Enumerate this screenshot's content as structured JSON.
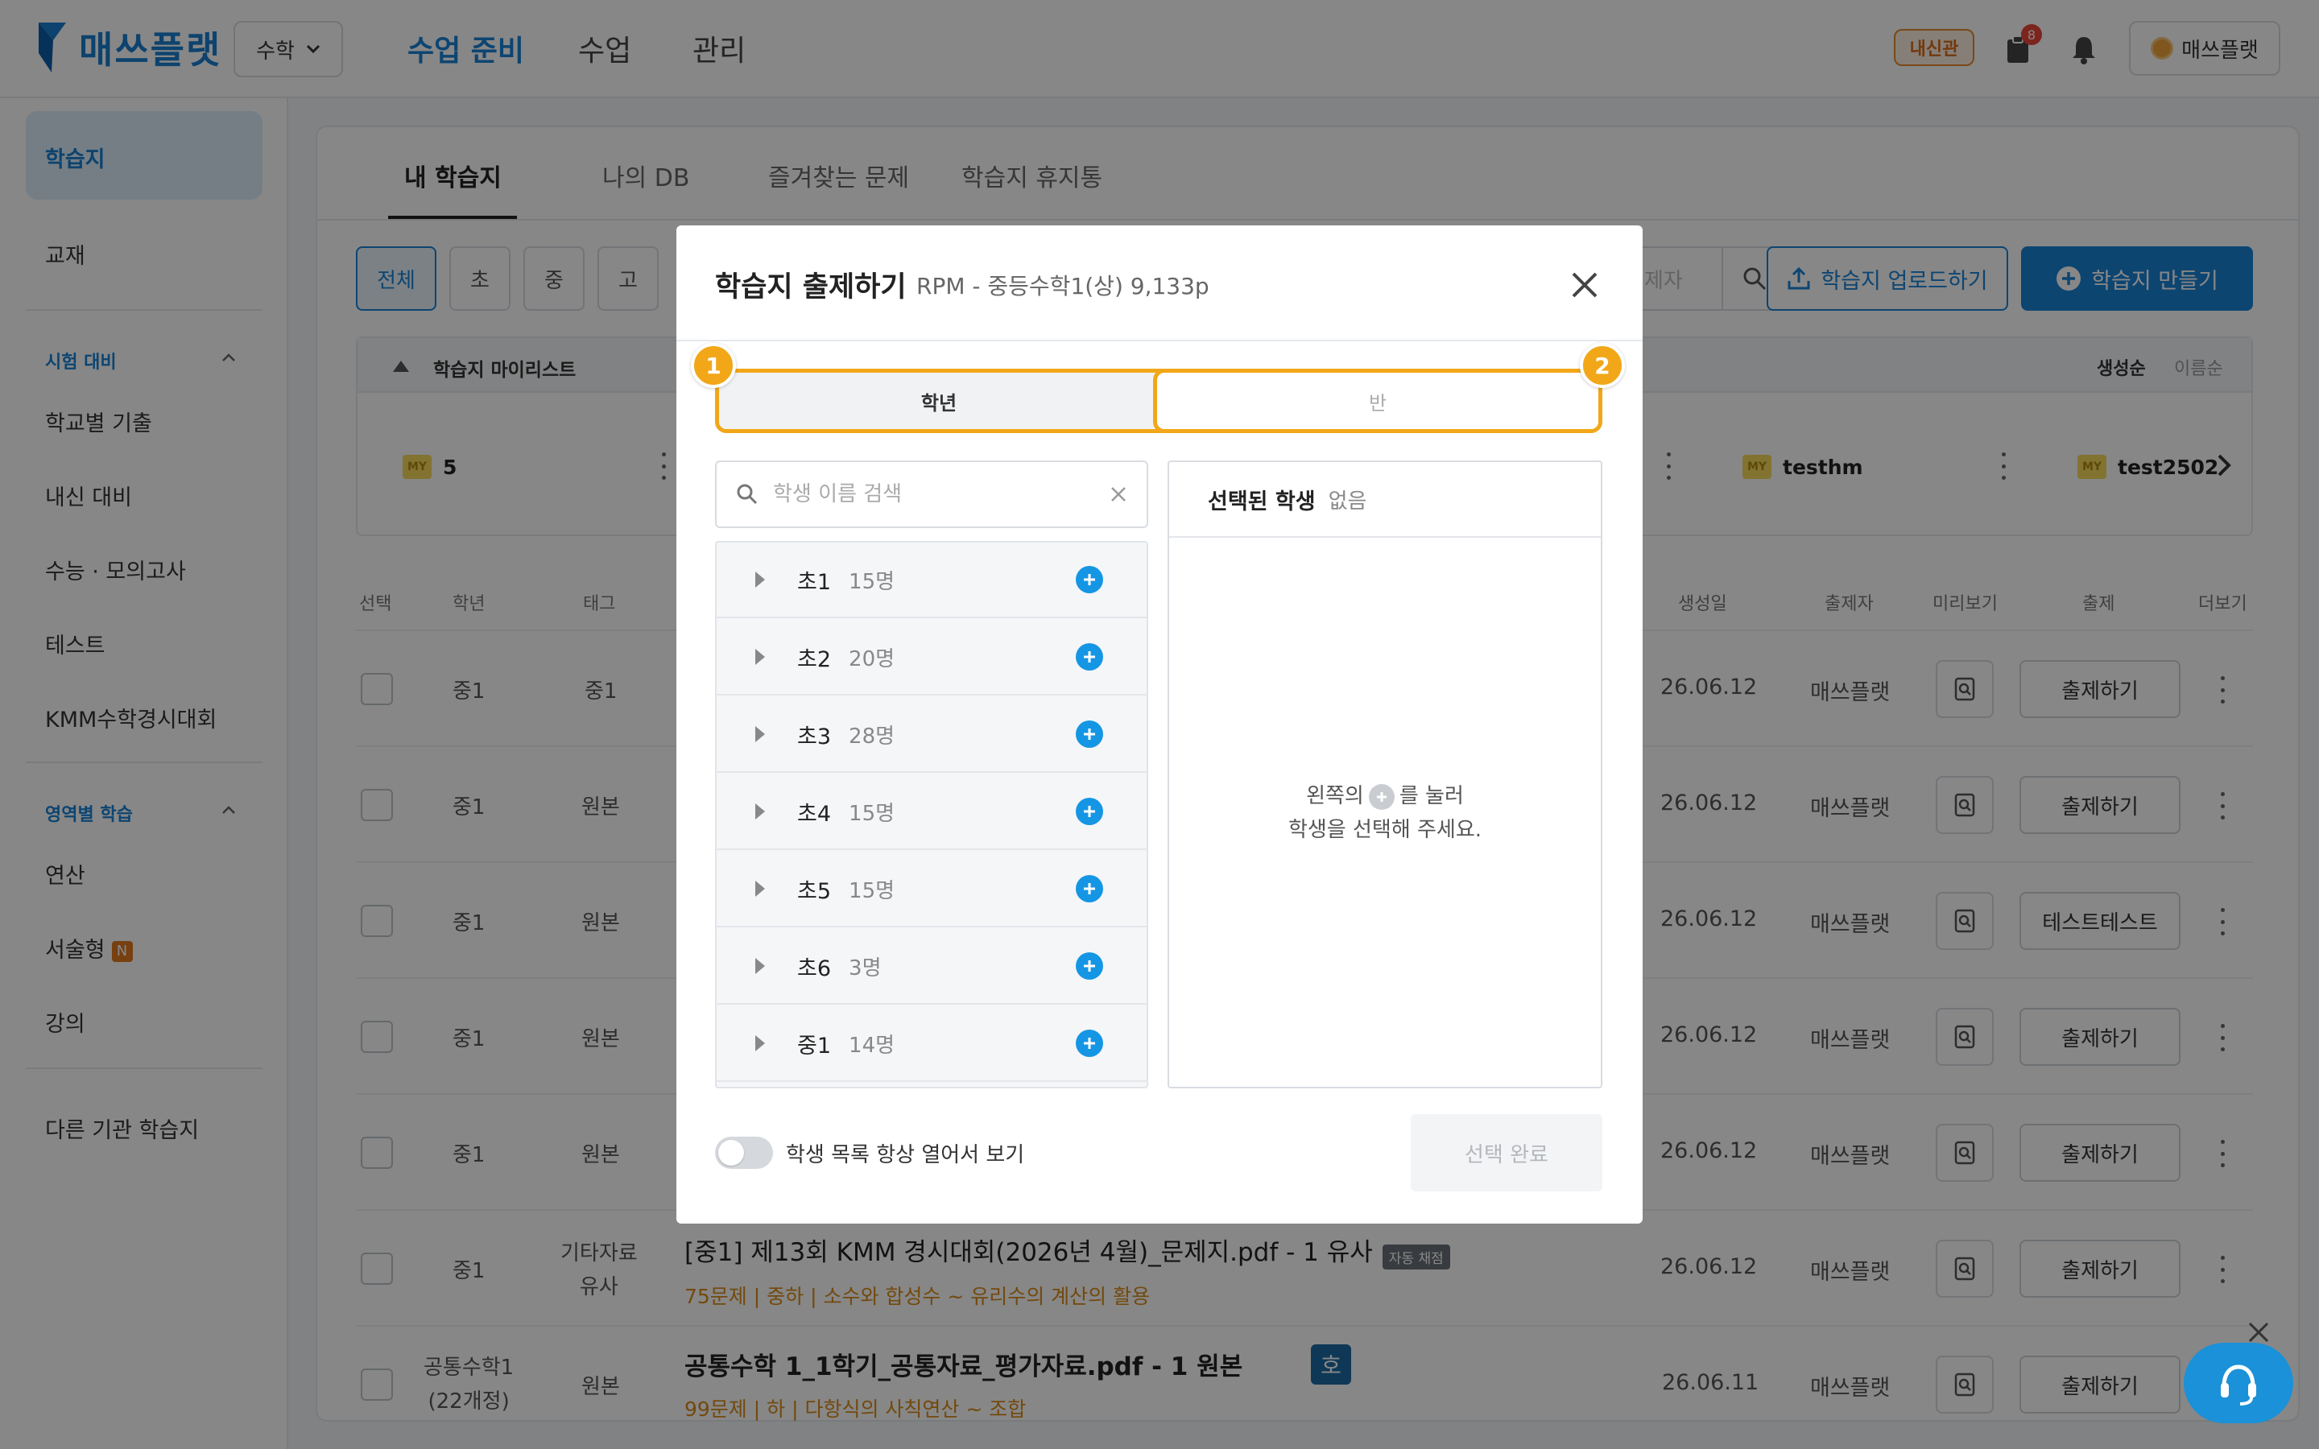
{
  "header": {
    "logo_text": "매쓰플랫",
    "subject": "수학",
    "nav": [
      "수업 준비",
      "수업",
      "관리"
    ],
    "badge": "내신관",
    "notification_count": "8",
    "user_name": "매쓰플랫"
  },
  "sidebar": {
    "items_top": [
      "학습지",
      "교재"
    ],
    "section1": "시험 대비",
    "section1_items": [
      "학교별 기출",
      "내신 대비",
      "수능 · 모의고사",
      "테스트",
      "KMM수학경시대회"
    ],
    "section2": "영역별 학습",
    "section2_items": [
      "연산",
      "서술형",
      "강의"
    ],
    "new_badge": "N",
    "bottom_item": "다른 기관 학습지"
  },
  "tabs": [
    "내 학습지",
    "나의 DB",
    "즐겨찾는 문제",
    "학습지 휴지통"
  ],
  "filters": [
    "전체",
    "초",
    "중",
    "고"
  ],
  "search_placeholder_visible": "제자",
  "toolbar": {
    "upload": "학습지 업로드하기",
    "make": "학습지 만들기"
  },
  "playlist": {
    "title": "학습지 마이리스트",
    "sort": [
      "생성순",
      "이름순"
    ],
    "my_label": "MY",
    "cards": [
      "5",
      "testhm",
      "test2502"
    ]
  },
  "table": {
    "headers": [
      "선택",
      "학년",
      "태그",
      "생성일",
      "출제자",
      "미리보기",
      "출제",
      "더보기"
    ],
    "rows": [
      {
        "grade": "중1",
        "tag": "중1",
        "date": "26.06.12",
        "author": "매쓰플랫",
        "action": "출제하기"
      },
      {
        "grade": "중1",
        "tag": "원본",
        "date": "26.06.12",
        "author": "매쓰플랫",
        "action": "출제하기"
      },
      {
        "grade": "중1",
        "tag": "원본",
        "date": "26.06.12",
        "author": "매쓰플랫",
        "action": "테스트테스트"
      },
      {
        "grade": "중1",
        "tag": "원본",
        "date": "26.06.12",
        "author": "매쓰플랫",
        "action": "출제하기"
      },
      {
        "grade": "중1",
        "tag": "원본",
        "date": "26.06.12",
        "author": "매쓰플랫",
        "action": "출제하기"
      },
      {
        "grade": "중1",
        "tag": "기타자료\n유사",
        "tag1": "기타자료",
        "tag2": "유사",
        "title": "[중1] 제13회 KMM 경시대회(2026년 4월)_문제지.pdf - 1 유사",
        "badge": "자동 채점",
        "sub": "75문제 | 중하 | 소수와 합성수 ~ 유리수의 계산의 활용",
        "date": "26.06.12",
        "author": "매쓰플랫",
        "action": "출제하기"
      },
      {
        "grade1": "공통수학1",
        "grade2": "(22개정)",
        "tag": "원본",
        "title": "공통수학 1_1학기_공통자료_평가자료.pdf - 1 원본",
        "badge": "호",
        "sub": "99문제 | 하 | 다항식의 사칙연산 ~ 조합",
        "date": "26.06.11",
        "author": "매쓰플랫",
        "action": "출제하기"
      }
    ]
  },
  "modal": {
    "title": "학습지 출제하기",
    "subtitle": "RPM - 중등수학1(상) 9,133p",
    "seg_left": "학년",
    "seg_right": "반",
    "step1": "1",
    "step2": "2",
    "search_placeholder": "학생 이름 검색",
    "groups": [
      {
        "name": "초1",
        "count": "15명"
      },
      {
        "name": "초2",
        "count": "20명"
      },
      {
        "name": "초3",
        "count": "28명"
      },
      {
        "name": "초4",
        "count": "15명"
      },
      {
        "name": "초5",
        "count": "15명"
      },
      {
        "name": "초6",
        "count": "3명"
      },
      {
        "name": "중1",
        "count": "14명"
      }
    ],
    "selected_title": "선택된 학생",
    "selected_empty": "없음",
    "hint_line1_a": "왼쪽의",
    "hint_line1_b": "를 눌러",
    "hint_line2": "학생을 선택해 주세요.",
    "toggle_label": "학생 목록 항상 열어서 보기",
    "done": "선택 완료"
  },
  "colors": {
    "primary": "#1a83d6",
    "highlight": "#f2a718",
    "add": "#1596e4"
  }
}
